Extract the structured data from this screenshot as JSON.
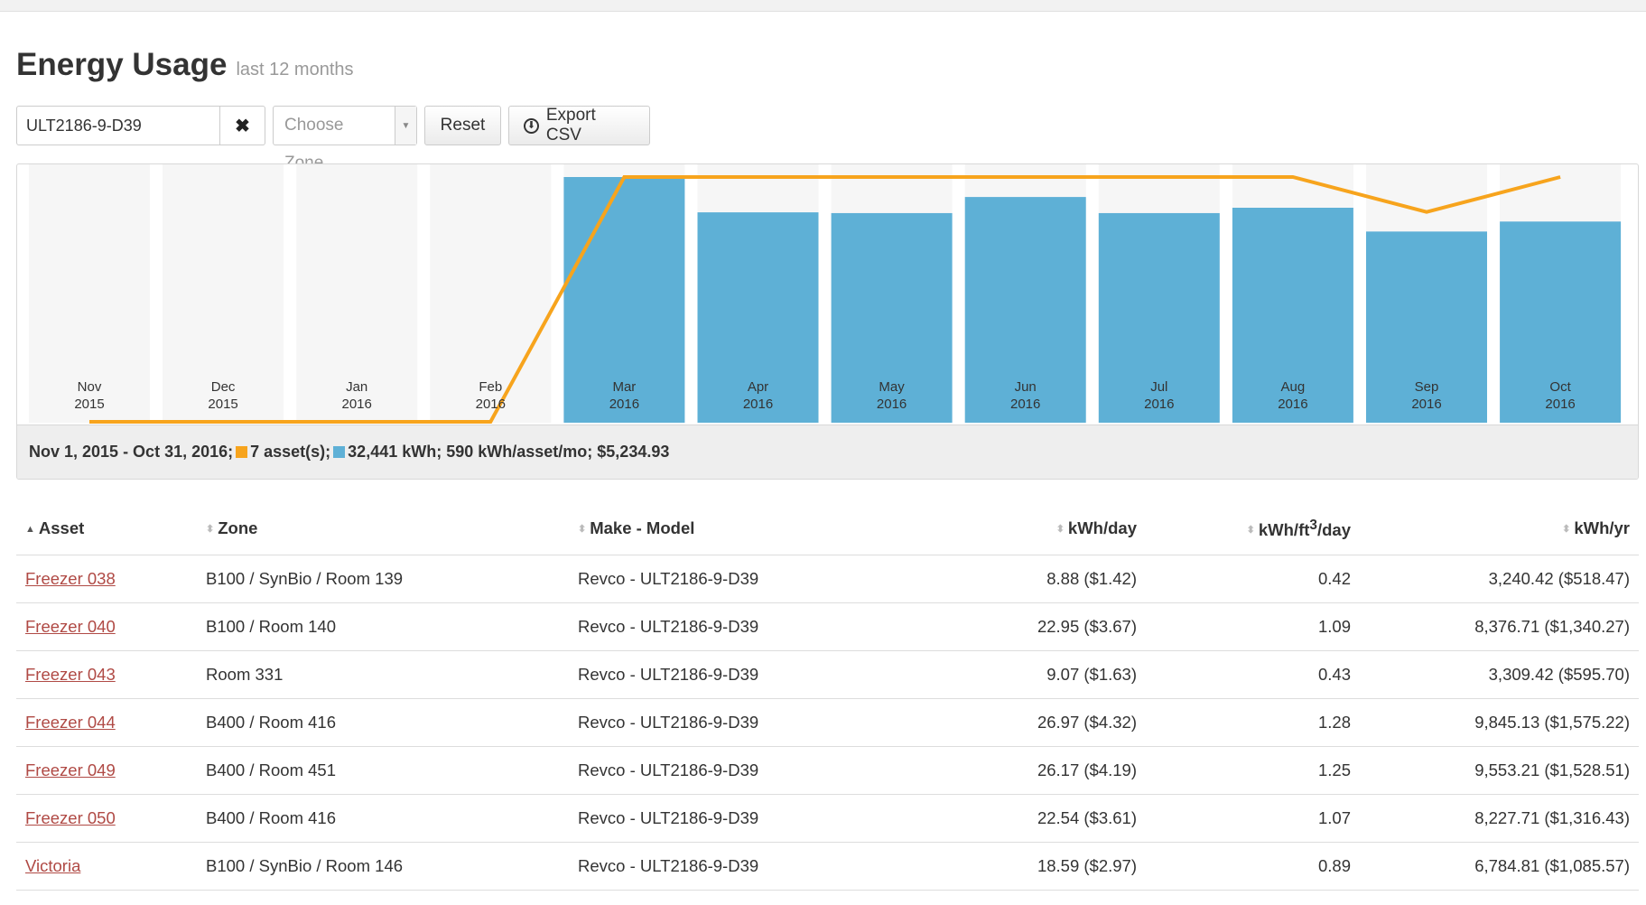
{
  "page": {
    "title": "Energy Usage",
    "subtitle": "last 12 months"
  },
  "controls": {
    "asset_value": "ULT2186-9-D39",
    "clear_icon": "✖",
    "zone_placeholder": "Choose Zone",
    "zone_arrow": "▼",
    "reset_label": "Reset",
    "export_icon": "⬇",
    "export_label": "Export CSV"
  },
  "summary": {
    "range": "Nov 1, 2015 - Oct 31, 2016;",
    "assets": "7 asset(s);",
    "totals": "32,441 kWh; 590 kWh/asset/mo; $5,234.93"
  },
  "colors": {
    "bar": "#5eb0d6",
    "line": "#f7a41d",
    "column_bg": "#f6f6f6"
  },
  "chart_data": {
    "type": "bar",
    "categories": [
      [
        "Nov",
        "2015"
      ],
      [
        "Dec",
        "2015"
      ],
      [
        "Jan",
        "2016"
      ],
      [
        "Feb",
        "2016"
      ],
      [
        "Mar",
        "2016"
      ],
      [
        "Apr",
        "2016"
      ],
      [
        "May",
        "2016"
      ],
      [
        "Jun",
        "2016"
      ],
      [
        "Jul",
        "2016"
      ],
      [
        "Aug",
        "2016"
      ],
      [
        "Sep",
        "2016"
      ],
      [
        "Oct",
        "2016"
      ]
    ],
    "series": [
      {
        "name": "kWh",
        "type": "bar",
        "values": [
          0,
          0,
          0,
          0,
          3200,
          2740,
          2730,
          2940,
          2730,
          2800,
          2490,
          2620
        ]
      },
      {
        "name": "asset(s)",
        "type": "line",
        "values": [
          0,
          0,
          0,
          0,
          7,
          7,
          7,
          7,
          7,
          7,
          6,
          7
        ]
      }
    ],
    "ylim": [
      0,
      3200
    ],
    "y2lim": [
      0,
      7
    ],
    "legend": "bottom"
  },
  "table": {
    "headers": {
      "asset": "Asset",
      "zone": "Zone",
      "model": "Make - Model",
      "kwh_day": "kWh/day",
      "kwh_ft_prefix": "kWh/ft",
      "kwh_ft_sup": "3",
      "kwh_ft_suffix": "/day",
      "kwh_yr": "kWh/yr"
    },
    "rows": [
      {
        "asset": "Freezer 038",
        "zone": "B100 / SynBio / Room 139",
        "model": "Revco - ULT2186-9-D39",
        "kwh_day": "8.88 ($1.42)",
        "kwh_ft": "0.42",
        "kwh_yr": "3,240.42 ($518.47)"
      },
      {
        "asset": "Freezer 040",
        "zone": "B100 / Room 140",
        "model": "Revco - ULT2186-9-D39",
        "kwh_day": "22.95 ($3.67)",
        "kwh_ft": "1.09",
        "kwh_yr": "8,376.71 ($1,340.27)"
      },
      {
        "asset": "Freezer 043",
        "zone": "Room 331",
        "model": "Revco - ULT2186-9-D39",
        "kwh_day": "9.07 ($1.63)",
        "kwh_ft": "0.43",
        "kwh_yr": "3,309.42 ($595.70)"
      },
      {
        "asset": "Freezer 044",
        "zone": "B400 / Room 416",
        "model": "Revco - ULT2186-9-D39",
        "kwh_day": "26.97 ($4.32)",
        "kwh_ft": "1.28",
        "kwh_yr": "9,845.13 ($1,575.22)"
      },
      {
        "asset": "Freezer 049",
        "zone": "B400 / Room 451",
        "model": "Revco - ULT2186-9-D39",
        "kwh_day": "26.17 ($4.19)",
        "kwh_ft": "1.25",
        "kwh_yr": "9,553.21 ($1,528.51)"
      },
      {
        "asset": "Freezer 050",
        "zone": "B400 / Room 416",
        "model": "Revco - ULT2186-9-D39",
        "kwh_day": "22.54 ($3.61)",
        "kwh_ft": "1.07",
        "kwh_yr": "8,227.71 ($1,316.43)"
      },
      {
        "asset": "Victoria",
        "zone": "B100 / SynBio / Room 146",
        "model": "Revco - ULT2186-9-D39",
        "kwh_day": "18.59 ($2.97)",
        "kwh_ft": "0.89",
        "kwh_yr": "6,784.81 ($1,085.57)"
      }
    ]
  }
}
